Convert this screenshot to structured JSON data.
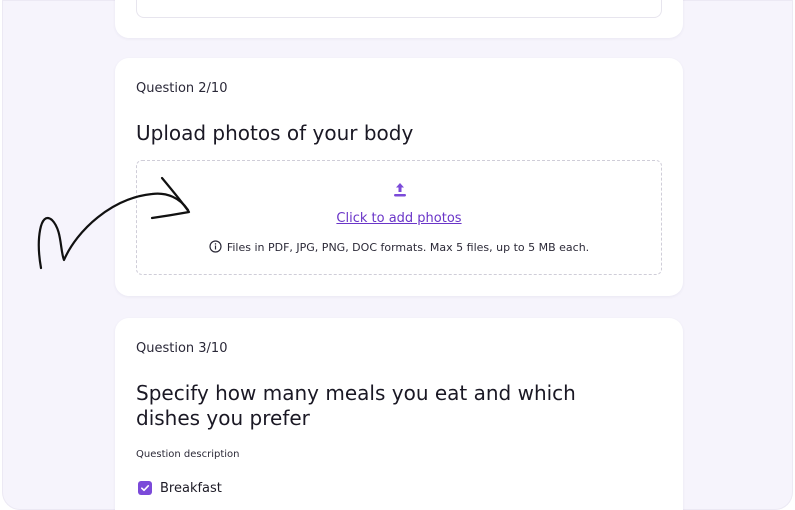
{
  "q2": {
    "label": "Question 2/10",
    "title": "Upload photos of your body",
    "upload_link": "Click to add photos",
    "hint": "Files in PDF, JPG, PNG, DOC formats. Max 5 files, up to 5 MB each."
  },
  "q3": {
    "label": "Question 3/10",
    "title": "Specify how many meals you eat and which dishes you prefer",
    "description": "Question description",
    "options": [
      {
        "label": "Breakfast",
        "checked": true
      }
    ]
  },
  "icons": {
    "upload": "upload-icon",
    "info": "info-icon",
    "check": "check-icon",
    "arrow": "hand-drawn-arrow"
  },
  "colors": {
    "accent": "#7b4ad9",
    "link": "#6a35c8",
    "background": "#f6f4fc",
    "card": "#ffffff"
  }
}
